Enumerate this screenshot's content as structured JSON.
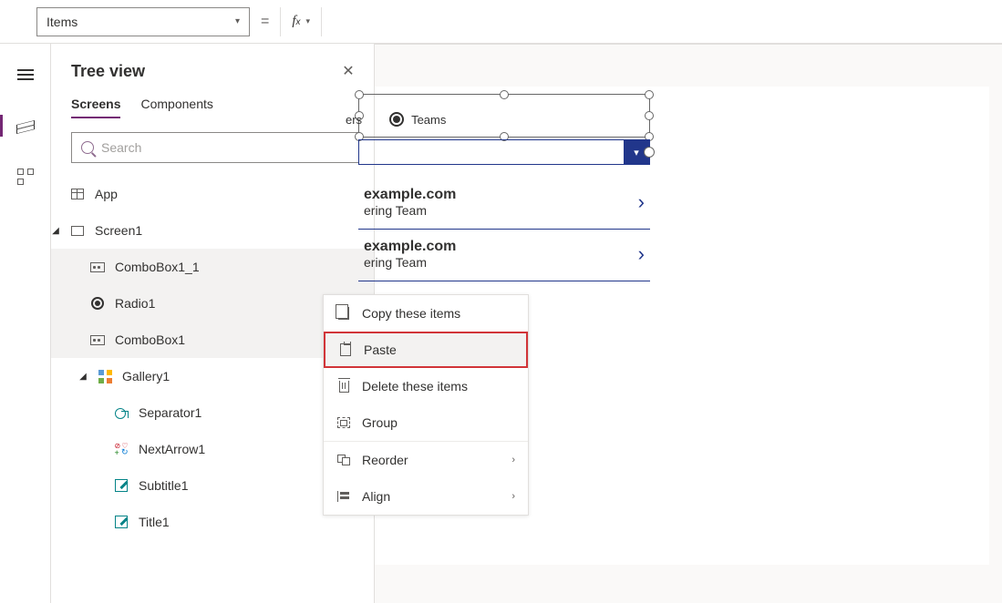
{
  "property_selector": {
    "value": "Items"
  },
  "tree_view": {
    "title": "Tree view",
    "tabs": {
      "screens": "Screens",
      "components": "Components"
    },
    "search_placeholder": "Search",
    "nodes": {
      "app": "App",
      "screen1": "Screen1",
      "combobox1_1": "ComboBox1_1",
      "radio1": "Radio1",
      "combobox1": "ComboBox1",
      "gallery1": "Gallery1",
      "separator1": "Separator1",
      "nextarrow1": "NextArrow1",
      "subtitle1": "Subtitle1",
      "title1": "Title1"
    }
  },
  "canvas": {
    "radio": {
      "opt1": "ers",
      "opt2": "Teams"
    },
    "gallery": [
      {
        "title": "example.com",
        "subtitle": "ering Team"
      },
      {
        "title": "example.com",
        "subtitle": "ering Team"
      }
    ]
  },
  "context_menu": {
    "copy": "Copy these items",
    "paste": "Paste",
    "delete": "Delete these items",
    "group": "Group",
    "reorder": "Reorder",
    "align": "Align"
  }
}
